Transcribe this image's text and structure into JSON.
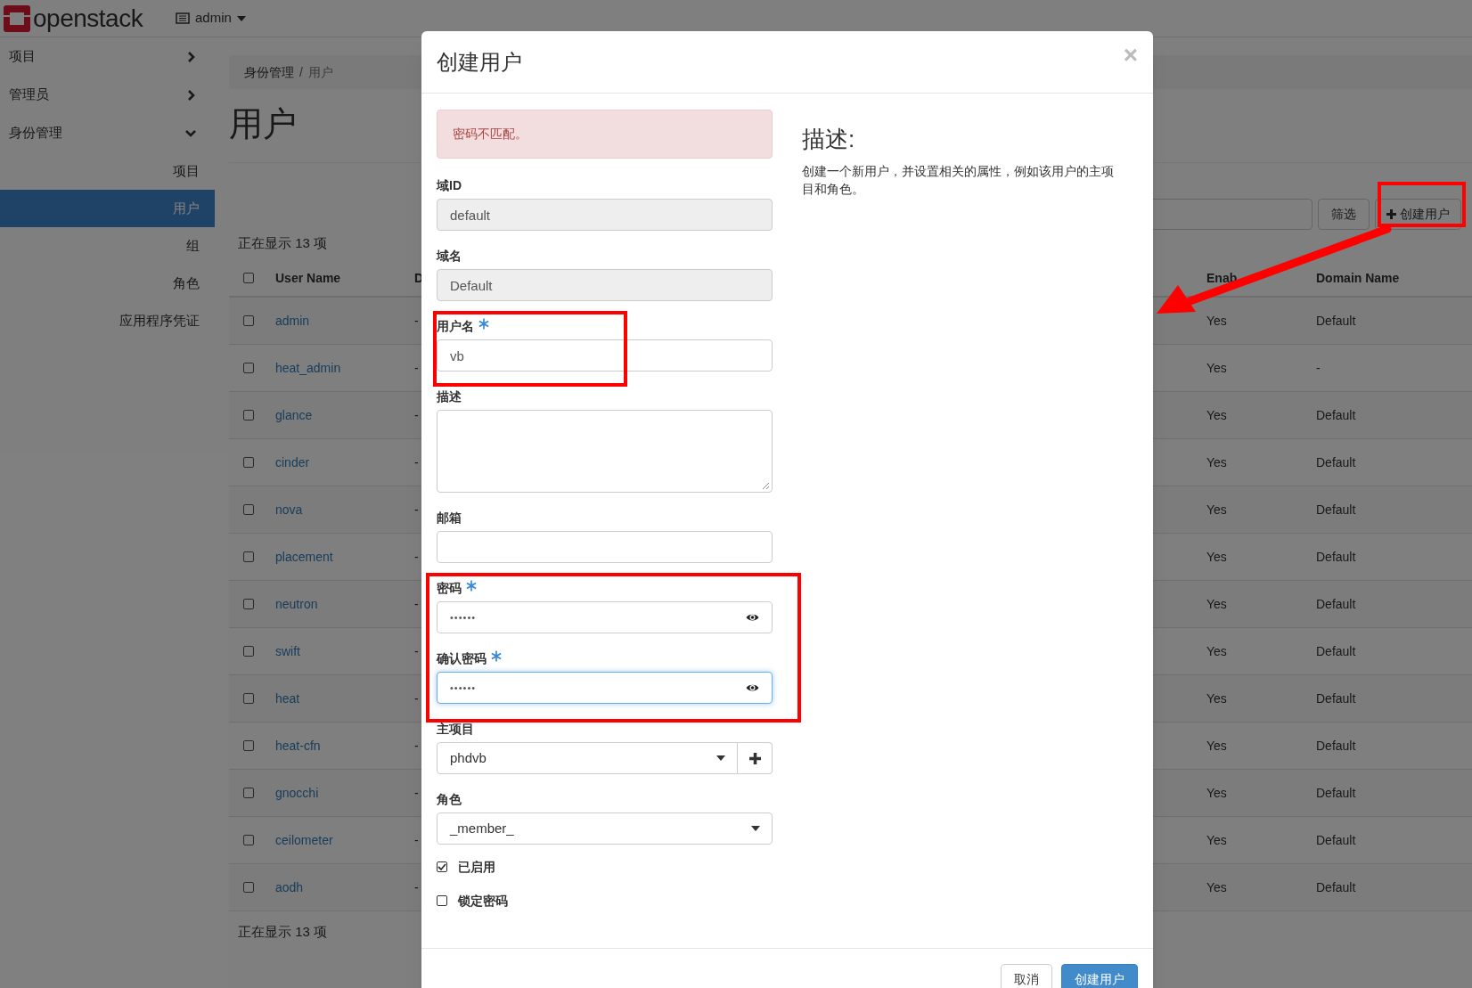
{
  "topbar": {
    "logo": "openstack",
    "user_menu": "admin"
  },
  "sidebar": {
    "items": [
      {
        "label": "项目",
        "expanded": false
      },
      {
        "label": "管理员",
        "expanded": false
      },
      {
        "label": "身份管理",
        "expanded": true,
        "children": [
          {
            "label": "项目",
            "selected": false
          },
          {
            "label": "用户",
            "selected": true
          },
          {
            "label": "组",
            "selected": false
          },
          {
            "label": "角色",
            "selected": false
          },
          {
            "label": "应用程序凭证",
            "selected": false
          }
        ]
      }
    ]
  },
  "main": {
    "breadcrumb": [
      "身份管理",
      "用户"
    ],
    "breadcrumb_separator": "/",
    "title": "用户",
    "filter_button": "筛选",
    "create_button": "创建用户",
    "count": "正在显示 13 项",
    "table": {
      "columns": [
        "User Name",
        "D",
        "Enab",
        "Domain Name"
      ],
      "header_checked": false,
      "rows": [
        {
          "checked": false,
          "cells": [
            "admin",
            "-",
            "Yes",
            "Default"
          ]
        },
        {
          "checked": false,
          "cells": [
            "heat_admin",
            "-",
            "Yes",
            "-"
          ]
        },
        {
          "checked": false,
          "cells": [
            "glance",
            "-",
            "Yes",
            "Default"
          ]
        },
        {
          "checked": false,
          "cells": [
            "cinder",
            "-",
            "Yes",
            "Default"
          ]
        },
        {
          "checked": false,
          "cells": [
            "nova",
            "-",
            "Yes",
            "Default"
          ]
        },
        {
          "checked": false,
          "cells": [
            "placement",
            "-",
            "Yes",
            "Default"
          ]
        },
        {
          "checked": false,
          "cells": [
            "neutron",
            "-",
            "Yes",
            "Default"
          ]
        },
        {
          "checked": false,
          "cells": [
            "swift",
            "-",
            "Yes",
            "Default"
          ]
        },
        {
          "checked": false,
          "cells": [
            "heat",
            "-",
            "Yes",
            "Default"
          ]
        },
        {
          "checked": false,
          "cells": [
            "heat-cfn",
            "-",
            "Yes",
            "Default"
          ]
        },
        {
          "checked": false,
          "cells": [
            "gnocchi",
            "-",
            "Yes",
            "Default"
          ]
        },
        {
          "checked": false,
          "cells": [
            "ceilometer",
            "-",
            "Yes",
            "Default"
          ]
        },
        {
          "checked": false,
          "cells": [
            "aodh",
            "-",
            "Yes",
            "Default"
          ]
        }
      ]
    },
    "footer_count": "正在显示 13 项"
  },
  "modal": {
    "title": "创建用户",
    "close": "×",
    "alert": "密码不匹配。",
    "fields": [
      {
        "kind": "text",
        "label": "域ID",
        "value": "default",
        "disabled": true,
        "required": false
      },
      {
        "kind": "text",
        "label": "域名",
        "value": "Default",
        "disabled": true,
        "required": false
      },
      {
        "kind": "text",
        "label": "用户名",
        "value": "vb",
        "disabled": false,
        "required": true
      },
      {
        "kind": "textarea",
        "label": "描述",
        "required": false
      },
      {
        "kind": "text",
        "label": "邮箱",
        "disabled": false,
        "required": false
      },
      {
        "kind": "password",
        "label": "密码",
        "value": "••••••",
        "required": true,
        "focused": false
      },
      {
        "kind": "password",
        "label": "确认密码",
        "value": "••••••",
        "required": true,
        "focused": true
      },
      {
        "kind": "select_add",
        "label": "主项目",
        "value": "phdvb",
        "required": false
      },
      {
        "kind": "select",
        "label": "角色",
        "value": "_member_",
        "required": false
      },
      {
        "kind": "checkbox",
        "label": "已启用",
        "checked": true
      },
      {
        "kind": "checkbox",
        "label": "锁定密码",
        "checked": false
      }
    ],
    "help_title": "描述:",
    "help_text": "创建一个新用户，并设置相关的属性，例如该用户的主项目和角色。",
    "buttons": [
      {
        "kind": "cancel",
        "label": "取消"
      },
      {
        "kind": "submit",
        "label": "创建用户"
      }
    ]
  },
  "annotations": [
    {
      "kind": "box"
    },
    {
      "kind": "box"
    },
    {
      "kind": "box"
    },
    {
      "kind": "arrow"
    }
  ]
}
